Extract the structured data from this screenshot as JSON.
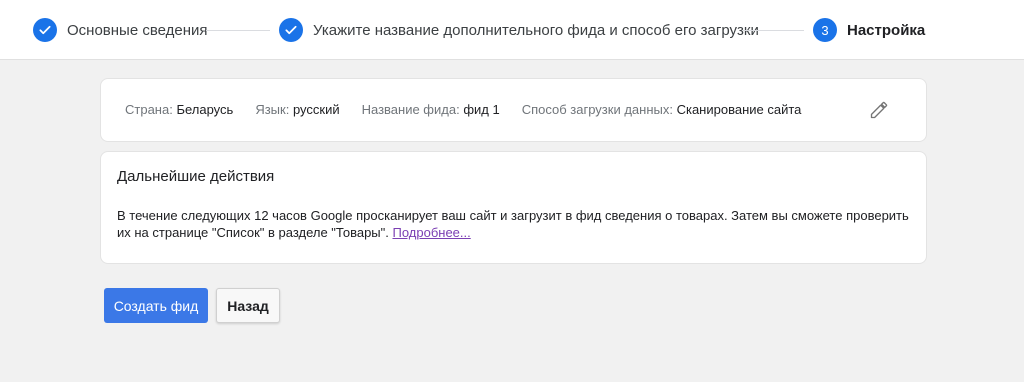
{
  "stepper": {
    "steps": [
      {
        "label": "Основные сведения",
        "state": "done",
        "icon": "check-icon"
      },
      {
        "label": "Укажите название дополнительного фида и способ его загрузки",
        "state": "done",
        "icon": "check-icon"
      },
      {
        "label": "Настройка",
        "state": "active",
        "number": "3"
      }
    ],
    "accent_color": "#1a73e8"
  },
  "summary": {
    "country_key": "Страна:",
    "country_val": "Беларусь",
    "language_key": "Язык:",
    "language_val": "русский",
    "feed_name_key": "Название фида:",
    "feed_name_val": "фид 1",
    "upload_key": "Способ загрузки данных:",
    "upload_val": "Сканирование сайта",
    "edit_icon": "pencil-icon"
  },
  "next_steps": {
    "title": "Дальнейшие действия",
    "body": "В течение следующих 12 часов Google просканирует ваш сайт и загрузит в фид сведения о товарах. Затем вы сможете проверить их на странице \"Список\" в разделе \"Товары\". ",
    "link": "Подробнее..."
  },
  "actions": {
    "create_label": "Создать фид",
    "back_label": "Назад"
  }
}
